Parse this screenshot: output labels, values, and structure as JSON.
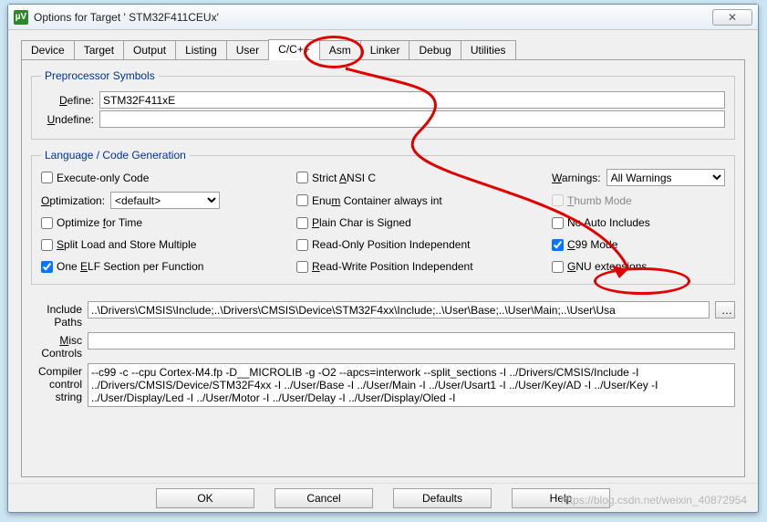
{
  "window": {
    "title": "Options for Target ' STM32F411CEUx'",
    "appicon_label": "µV"
  },
  "tabs": [
    "Device",
    "Target",
    "Output",
    "Listing",
    "User",
    "C/C++",
    "Asm",
    "Linker",
    "Debug",
    "Utilities"
  ],
  "active_tab_index": 5,
  "preproc": {
    "legend": "Preprocessor Symbols",
    "define_label": "Define:",
    "define_value": "STM32F411xE",
    "undefine_label": "Undefine:",
    "undefine_value": ""
  },
  "lang": {
    "legend": "Language / Code Generation",
    "exec_only": {
      "label": "Execute-only Code",
      "checked": false
    },
    "strict_ansi": {
      "label_pre": "Strict ",
      "label_u": "A",
      "label_post": "NSI C",
      "checked": false
    },
    "warnings_label": "Warnings:",
    "warnings_value": "All Warnings",
    "optimization_label_pre": "O",
    "optimization_u": "ptimization:",
    "optimization_value": "<default>",
    "enum_container": {
      "label_pre": "Enu",
      "label_u": "m",
      "label_post": " Container always int",
      "checked": false
    },
    "thumb_mode": {
      "label_pre": "",
      "label_u": "T",
      "label_post": "humb Mode",
      "checked": false
    },
    "opt_time": {
      "label_pre": "Optimize ",
      "label_u": "f",
      "label_post": "or Time",
      "checked": false
    },
    "plain_char": {
      "label_pre": "",
      "label_u": "P",
      "label_post": "lain Char is Signed",
      "checked": false
    },
    "no_auto": {
      "label": "No Auto Includes",
      "checked": false
    },
    "split_load": {
      "label_pre": "",
      "label_u": "S",
      "label_post": "plit Load and Store Multiple",
      "checked": false
    },
    "ro_pi": {
      "label": "Read-Only Position Independent",
      "checked": false
    },
    "c99": {
      "label_pre": "",
      "label_u": "C",
      "label_post": "99 Mode",
      "checked": true
    },
    "one_elf": {
      "label_pre": "One ",
      "label_u": "E",
      "label_post": "LF Section per Function",
      "checked": true
    },
    "rw_pi": {
      "label_pre": "",
      "label_u": "R",
      "label_post": "ead-Write Position Independent",
      "checked": false
    },
    "gnu": {
      "label_pre": "",
      "label_u": "G",
      "label_post": "NU extensions",
      "checked": false
    }
  },
  "paths": {
    "include_label": "Include\nPaths",
    "include_value": "..\\Drivers\\CMSIS\\Include;..\\Drivers\\CMSIS\\Device\\STM32F4xx\\Include;..\\User\\Base;..\\User\\Main;..\\User\\Usa",
    "misc_label": "Misc\nControls",
    "misc_u": "M",
    "misc_value": "",
    "compiler_label": "Compiler\ncontrol\nstring",
    "compiler_value": "--c99 -c --cpu Cortex-M4.fp -D__MICROLIB -g -O2 --apcs=interwork --split_sections -I ../Drivers/CMSIS/Include -I ../Drivers/CMSIS/Device/STM32F4xx -I ../User/Base -I ../User/Main -I ../User/Usart1 -I ../User/Key/AD -I ../User/Key -I ../User/Display/Led -I ../User/Motor -I ../User/Delay -I ../User/Display/Oled -I"
  },
  "buttons": {
    "ok": "OK",
    "cancel": "Cancel",
    "defaults": "Defaults",
    "help": "Help"
  },
  "watermark": "https://blog.csdn.net/weixin_40872954"
}
